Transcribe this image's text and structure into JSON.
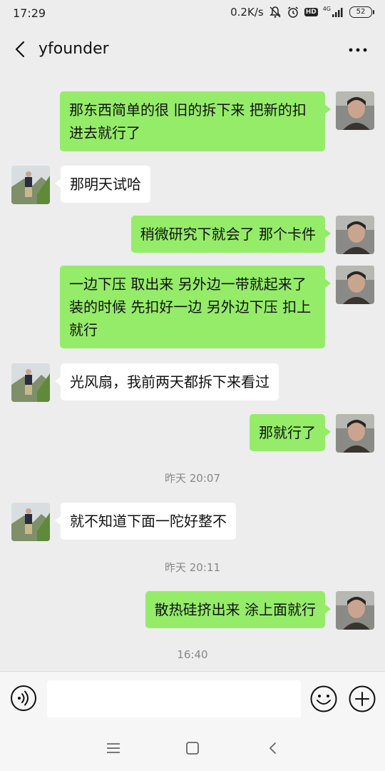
{
  "status_bar": {
    "time": "17:29",
    "speed": "0.2K/s",
    "network": "4G",
    "hd": "HD",
    "battery": "52"
  },
  "header": {
    "title": "yfounder"
  },
  "messages": [
    {
      "side": "me",
      "text": "那东西简单的很  旧的拆下来  把新的扣进去就行了"
    },
    {
      "side": "other",
      "text": "那明天试哈"
    },
    {
      "side": "me",
      "text": "稍微研究下就会了  那个卡件"
    },
    {
      "side": "me",
      "text": "一边下压  取出来  另外边一带就起来了  装的时候  先扣好一边  另外边下压 扣上就行"
    },
    {
      "side": "other",
      "text": "光风扇，我前两天都拆下来看过"
    },
    {
      "side": "me",
      "text": "那就行了"
    },
    {
      "side": "other",
      "text": "就不知道下面一陀好整不"
    },
    {
      "side": "me",
      "text": "散热硅挤出来 涂上面就行"
    }
  ],
  "timestamps": [
    "昨天 20:07",
    "昨天 20:11",
    "16:40"
  ],
  "input": {
    "value": ""
  },
  "colors": {
    "background": "#ededed",
    "my_bubble": "#95ec69",
    "other_bubble": "#ffffff"
  }
}
